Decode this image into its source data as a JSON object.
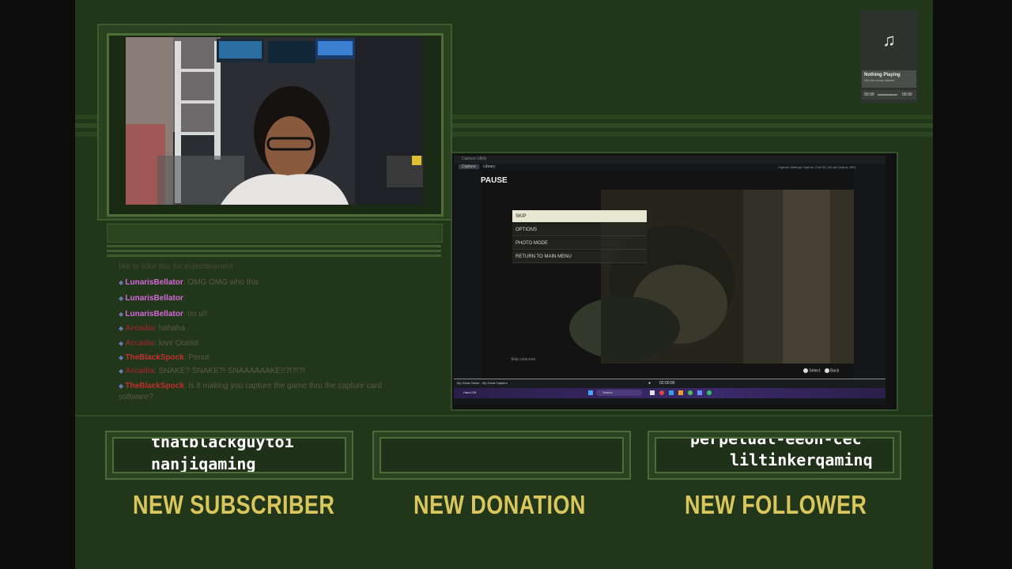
{
  "chat": {
    "partial_line": "like to take this for entertainment",
    "messages": [
      {
        "user": "LunarisBellator",
        "text": "OMG OMG who this",
        "color": "#d26ad8"
      },
      {
        "user": "LunarisBellator",
        "text": "",
        "color": "#d26ad8"
      },
      {
        "user": "LunarisBellator",
        "text": "no u!!",
        "color": "#d26ad8"
      },
      {
        "user": "Arcadia",
        "text": "hahaha",
        "color": "#8a2a2a"
      },
      {
        "user": "Arcadia",
        "text": "love Ocelot",
        "color": "#8a2a2a"
      },
      {
        "user": "TheBlackSpock",
        "text": "Penut",
        "color": "#c23030"
      },
      {
        "user": "Arcadia",
        "text": "SNAKE? SNAKE?! SNAAAAAAKE!!?!?!?!",
        "color": "#8a2a2a"
      },
      {
        "user": "TheBlackSpock",
        "text": "is it making you capture the game thru the capture card",
        "color": "#c23030"
      }
    ],
    "wrap_line": "software?"
  },
  "game": {
    "window_title": "Capture Utility",
    "tabs": [
      "Capture",
      "Library"
    ],
    "top_right": "Capture Settings   Capture: Full HD | 60 fps   Output: MP4",
    "pause_title": "PAUSE",
    "menu": [
      "SKIP",
      "OPTIONS",
      "PHOTO MODE",
      "RETURN TO MAIN MENU"
    ],
    "hint": "Skip cutscene",
    "buttons": [
      "Select",
      "Back"
    ],
    "clip_name": "My Great Game - My Great Capture",
    "timecode": "02:00:00",
    "taskbar_left": "Hand-Off",
    "search": "Search"
  },
  "music": {
    "title": "Nothing Playing",
    "subtitle": "Get the music started",
    "time_start": "00:00",
    "time_end": "00:00"
  },
  "alerts": {
    "subscriber": {
      "label": "NEW SUBSCRIBER",
      "names": [
        "thatblackguytoi",
        "nanjiqaming"
      ]
    },
    "donation": {
      "label": "NEW DONATION"
    },
    "follower": {
      "label": "NEW FOLLOWER",
      "names": [
        "perpetual-eeon-cec",
        "liltinkerqaminq"
      ]
    }
  }
}
